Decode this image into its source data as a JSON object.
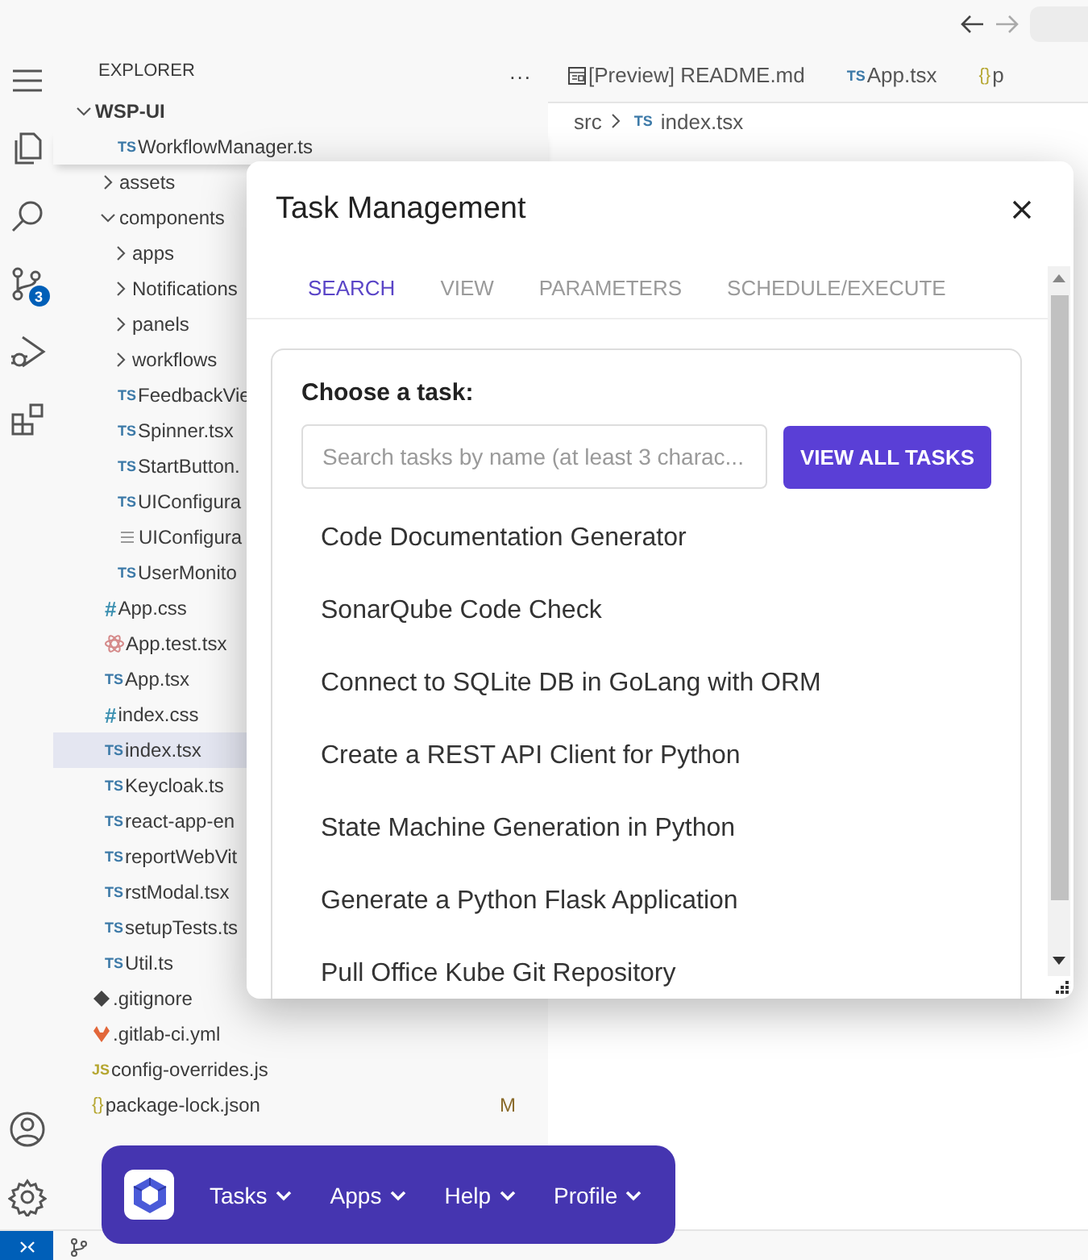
{
  "activity_bar": {
    "items": [
      {
        "kind": "menu"
      },
      {
        "kind": "files"
      },
      {
        "kind": "search"
      },
      {
        "kind": "source-control",
        "badge": "3"
      },
      {
        "kind": "run-debug"
      },
      {
        "kind": "extensions"
      }
    ],
    "bottom_items": [
      {
        "kind": "account"
      },
      {
        "kind": "settings"
      }
    ]
  },
  "explorer": {
    "title": "EXPLORER",
    "more": "...",
    "root": {
      "label": "WSP-UI",
      "expanded": true
    },
    "sticky_item": {
      "kind": "ts",
      "badge": "TS",
      "label": "WorkflowManager.ts"
    },
    "src_items": [
      {
        "kind": "folder",
        "label": "assets",
        "expanded": false,
        "selected": false
      },
      {
        "kind": "folder",
        "label": "components",
        "expanded": true,
        "selected": false,
        "children": [
          {
            "kind": "folder",
            "label": "apps",
            "expanded": false,
            "selected": false
          },
          {
            "kind": "folder",
            "label": "Notifications",
            "expanded": false,
            "selected": false
          },
          {
            "kind": "folder",
            "label": "panels",
            "expanded": false,
            "selected": false
          },
          {
            "kind": "folder",
            "label": "workflows",
            "expanded": false,
            "selected": false
          },
          {
            "kind": "ts",
            "badge": "TS",
            "label": "FeedbackVie",
            "selected": false
          },
          {
            "kind": "ts",
            "badge": "TS",
            "label": "Spinner.tsx",
            "selected": false
          },
          {
            "kind": "ts",
            "badge": "TS",
            "label": "StartButton.",
            "selected": false
          },
          {
            "kind": "ts",
            "badge": "TS",
            "label": "UIConfigura",
            "selected": false
          },
          {
            "kind": "lines",
            "label": "UIConfigura",
            "selected": false
          },
          {
            "kind": "ts",
            "badge": "TS",
            "label": "UserMonito",
            "selected": false
          }
        ]
      },
      {
        "kind": "css",
        "badge": "#",
        "label": "App.css",
        "selected": false
      },
      {
        "kind": "react",
        "label": "App.test.tsx",
        "selected": false
      },
      {
        "kind": "ts",
        "badge": "TS",
        "label": "App.tsx",
        "selected": false
      },
      {
        "kind": "css",
        "badge": "#",
        "label": "index.css",
        "selected": false
      },
      {
        "kind": "ts",
        "badge": "TS",
        "label": "index.tsx",
        "selected": true
      },
      {
        "kind": "ts",
        "badge": "TS",
        "label": "Keycloak.ts",
        "selected": false
      },
      {
        "kind": "ts",
        "badge": "TS",
        "label": "react-app-en",
        "selected": false
      },
      {
        "kind": "ts",
        "badge": "TS",
        "label": "reportWebVit",
        "selected": false
      },
      {
        "kind": "ts",
        "badge": "TS",
        "label": "rstModal.tsx",
        "selected": false
      },
      {
        "kind": "ts",
        "badge": "TS",
        "label": "setupTests.ts",
        "selected": false
      },
      {
        "kind": "ts",
        "badge": "TS",
        "label": "Util.ts",
        "selected": false
      }
    ],
    "root_items": [
      {
        "kind": "git",
        "label": ".gitignore",
        "selected": false
      },
      {
        "kind": "gitlab",
        "label": ".gitlab-ci.yml",
        "selected": false
      },
      {
        "kind": "js",
        "badge": "JS",
        "label": "config-overrides.js",
        "selected": false
      },
      {
        "kind": "json",
        "badge": "{}",
        "label": "package-lock.json",
        "status": "M",
        "selected": false
      }
    ]
  },
  "editor": {
    "tabs": [
      {
        "kind": "preview",
        "label": "[Preview] README.md",
        "selected": false
      },
      {
        "kind": "ts",
        "badge": "TS",
        "label": "App.tsx",
        "selected": false
      },
      {
        "kind": "json",
        "badge": "{}",
        "label": "p",
        "selected": false
      }
    ],
    "breadcrumb": [
      {
        "label": "src"
      },
      {
        "badge": "TS",
        "label": "index.tsx"
      }
    ]
  },
  "modal": {
    "title": "Task Management",
    "tabs": [
      {
        "label": "SEARCH",
        "selected": true
      },
      {
        "label": "VIEW",
        "selected": false
      },
      {
        "label": "PARAMETERS",
        "selected": false
      },
      {
        "label": "SCHEDULE/EXECUTE",
        "selected": false
      }
    ],
    "prompt": "Choose a task:",
    "search": {
      "placeholder": "Search tasks by name (at least 3 charac..."
    },
    "button": "VIEW ALL TASKS",
    "tasks": [
      "Code Documentation Generator",
      "SonarQube Code Check",
      "Connect to SQLite DB in GoLang with ORM",
      "Create a REST API Client for Python",
      "State Machine Generation in Python",
      "Generate a Python Flask Application",
      "Pull Office Kube Git Repository"
    ]
  },
  "app_bar": {
    "menus": [
      "Tasks",
      "Apps",
      "Help",
      "Profile"
    ]
  }
}
